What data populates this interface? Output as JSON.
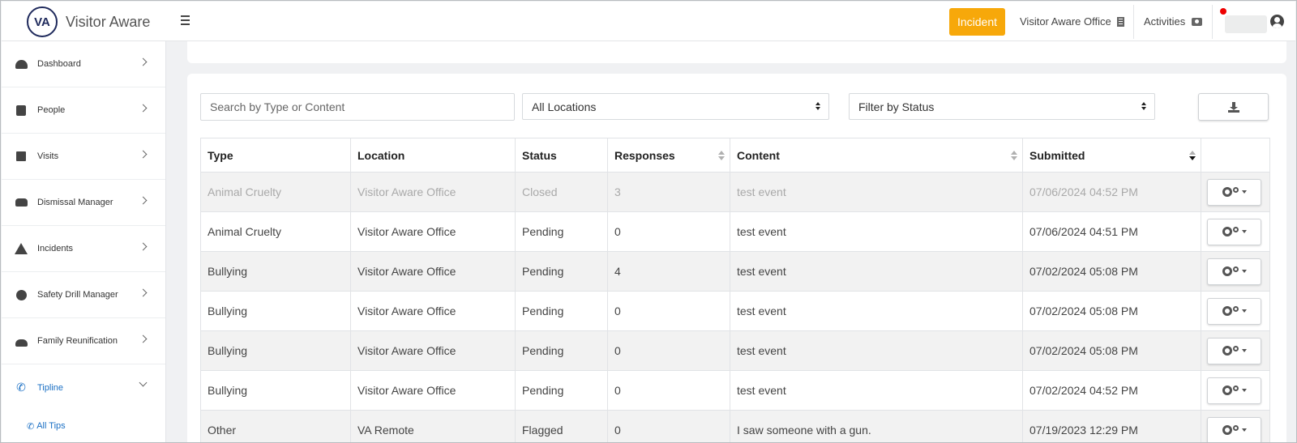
{
  "app": {
    "logo_text": "VA",
    "name": "Visitor Aware"
  },
  "header": {
    "incident_label": "Incident",
    "office_label": "Visitor Aware Office",
    "activities_label": "Activities"
  },
  "sidebar": {
    "items": [
      {
        "label": "Dashboard",
        "icon": "dashboard-icon"
      },
      {
        "label": "People",
        "icon": "people-icon"
      },
      {
        "label": "Visits",
        "icon": "calendar-icon"
      },
      {
        "label": "Dismissal Manager",
        "icon": "car-icon"
      },
      {
        "label": "Incidents",
        "icon": "warning-icon"
      },
      {
        "label": "Safety Drill Manager",
        "icon": "clock-icon"
      },
      {
        "label": "Family Reunification",
        "icon": "hand-icon"
      },
      {
        "label": "Tipline",
        "icon": "phone-icon"
      }
    ],
    "sub_items": [
      {
        "label": "All Tips",
        "icon": "phone-icon"
      }
    ]
  },
  "filters": {
    "search_placeholder": "Search by Type or Content",
    "location_selected": "All Locations",
    "status_selected": "Filter by Status"
  },
  "table": {
    "columns": [
      "Type",
      "Location",
      "Status",
      "Responses",
      "Content",
      "Submitted"
    ],
    "rows": [
      {
        "type": "Animal Cruelty",
        "location": "Visitor Aware Office",
        "status": "Closed",
        "responses": "3",
        "content": "test event",
        "submitted": "07/06/2024 04:52 PM"
      },
      {
        "type": "Animal Cruelty",
        "location": "Visitor Aware Office",
        "status": "Pending",
        "responses": "0",
        "content": "test event",
        "submitted": "07/06/2024 04:51 PM"
      },
      {
        "type": "Bullying",
        "location": "Visitor Aware Office",
        "status": "Pending",
        "responses": "4",
        "content": "test event",
        "submitted": "07/02/2024 05:08 PM"
      },
      {
        "type": "Bullying",
        "location": "Visitor Aware Office",
        "status": "Pending",
        "responses": "0",
        "content": "test event",
        "submitted": "07/02/2024 05:08 PM"
      },
      {
        "type": "Bullying",
        "location": "Visitor Aware Office",
        "status": "Pending",
        "responses": "0",
        "content": "test event",
        "submitted": "07/02/2024 05:08 PM"
      },
      {
        "type": "Bullying",
        "location": "Visitor Aware Office",
        "status": "Pending",
        "responses": "0",
        "content": "test event",
        "submitted": "07/02/2024 04:52 PM"
      },
      {
        "type": "Other",
        "location": "VA Remote",
        "status": "Flagged",
        "responses": "0",
        "content": "I saw someone with a gun.",
        "submitted": "07/19/2023 12:29 PM"
      }
    ]
  },
  "colors": {
    "accent": "#f7a80a",
    "link": "#1a6fc4",
    "brand": "#1f2a5c"
  }
}
